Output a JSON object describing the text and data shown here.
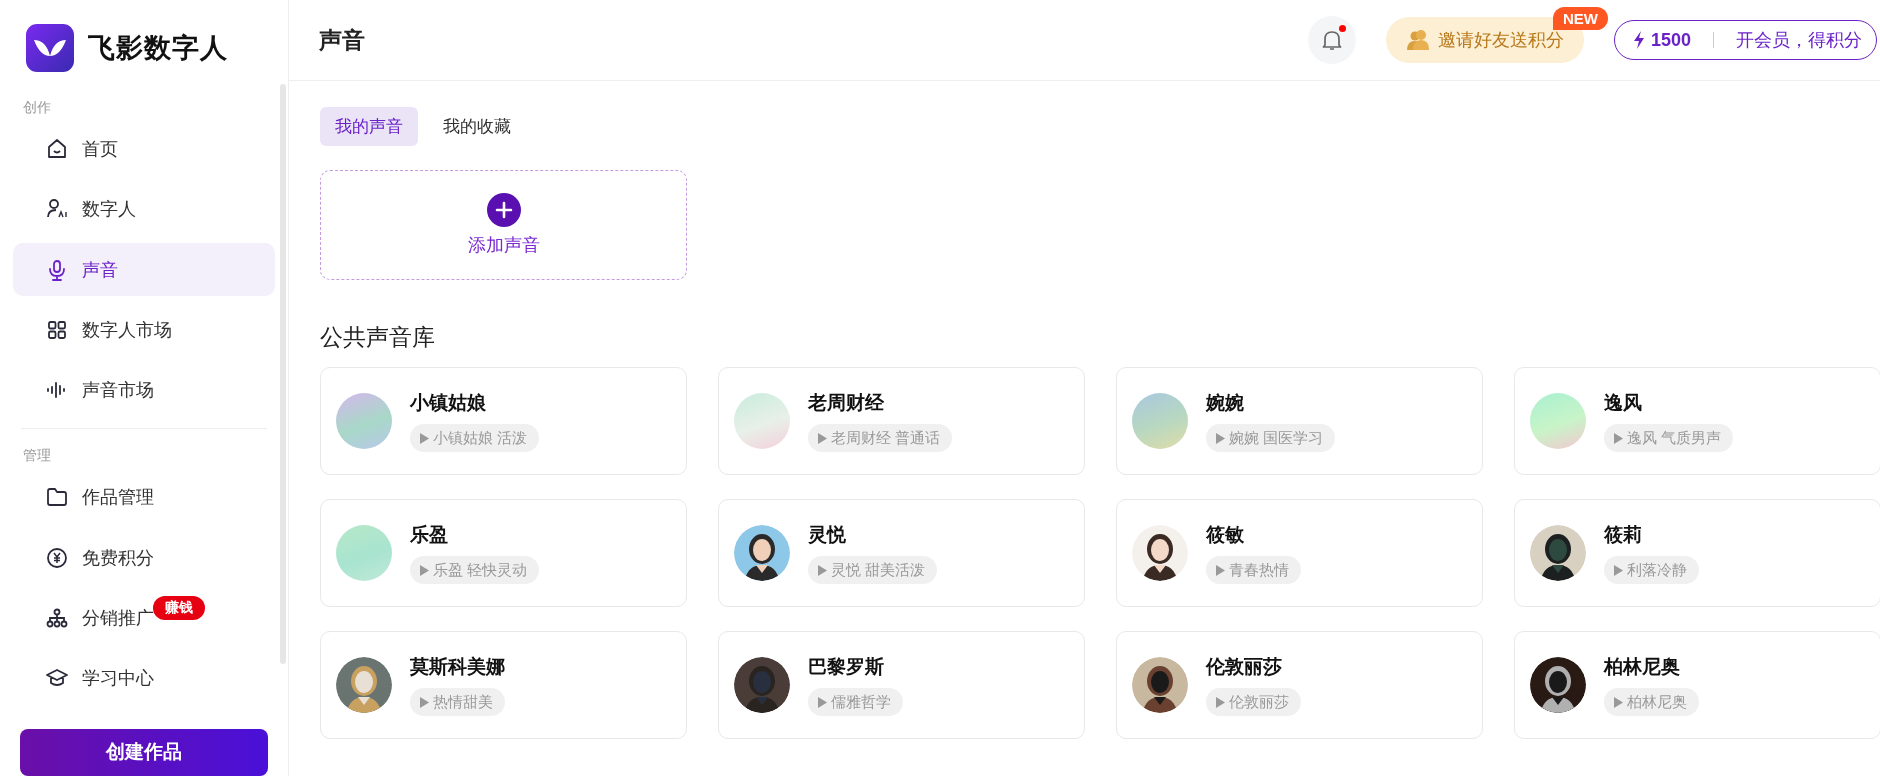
{
  "brand": {
    "name": "飞影数字人"
  },
  "sidebar": {
    "sections": [
      {
        "title": "创作",
        "items": [
          {
            "label": "首页",
            "selected": false
          },
          {
            "label": "数字人",
            "selected": false
          },
          {
            "label": "声音",
            "selected": true
          },
          {
            "label": "数字人市场",
            "selected": false
          },
          {
            "label": "声音市场",
            "selected": false
          }
        ]
      },
      {
        "title": "管理",
        "items": [
          {
            "label": "作品管理",
            "selected": false
          },
          {
            "label": "免费积分",
            "selected": false
          },
          {
            "label": "分销推广",
            "selected": false,
            "badge": "赚钱"
          },
          {
            "label": "学习中心",
            "selected": false
          }
        ]
      }
    ],
    "create_button": "创建作品"
  },
  "header": {
    "title": "声音",
    "notification_dot": true,
    "invite": {
      "label": "邀请好友送积分",
      "badge": "NEW"
    },
    "points": {
      "value": "1500",
      "label": "开会员，得积分"
    }
  },
  "tabs": [
    {
      "label": "我的声音",
      "selected": true
    },
    {
      "label": "我的收藏",
      "selected": false
    }
  ],
  "add_voice": {
    "label": "添加声音"
  },
  "library": {
    "title": "公共声音库",
    "voices": [
      {
        "name": "小镇姑娘",
        "tag": "小镇姑娘 活泼",
        "kind": "gradient"
      },
      {
        "name": "老周财经",
        "tag": "老周财经 普通话",
        "kind": "gradient"
      },
      {
        "name": "婉婉",
        "tag": "婉婉 国医学习",
        "kind": "gradient"
      },
      {
        "name": "逸风",
        "tag": "逸风 气质男声",
        "kind": "gradient"
      },
      {
        "name": "乐盈",
        "tag": "乐盈 轻快灵动",
        "kind": "gradient"
      },
      {
        "name": "灵悦",
        "tag": "灵悦 甜美活泼",
        "kind": "picture"
      },
      {
        "name": "筱敏",
        "tag": "青春热情",
        "kind": "picture"
      },
      {
        "name": "筱莉",
        "tag": "利落冷静",
        "kind": "picture"
      },
      {
        "name": "莫斯科美娜",
        "tag": "热情甜美",
        "kind": "picture"
      },
      {
        "name": "巴黎罗斯",
        "tag": "儒雅哲学",
        "kind": "picture"
      },
      {
        "name": "伦敦丽莎",
        "tag": "伦敦丽莎",
        "kind": "picture"
      },
      {
        "name": "柏林尼奥",
        "tag": "柏林尼奥",
        "kind": "picture"
      }
    ]
  }
}
